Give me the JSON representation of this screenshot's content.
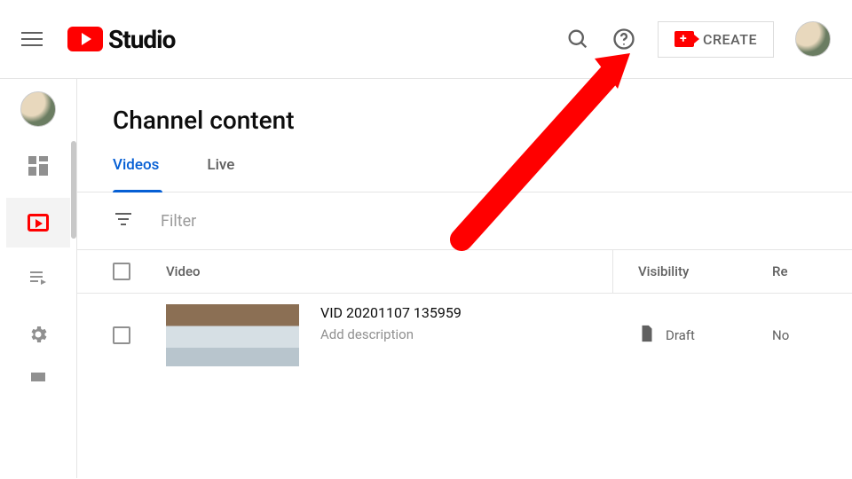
{
  "header": {
    "logo_text": "Studio",
    "create_label": "CREATE"
  },
  "page": {
    "title": "Channel content"
  },
  "tabs": [
    {
      "label": "Videos",
      "active": true
    },
    {
      "label": "Live",
      "active": false
    }
  ],
  "filter": {
    "placeholder": "Filter"
  },
  "table": {
    "columns": {
      "video": "Video",
      "visibility": "Visibility",
      "re": "Re"
    },
    "rows": [
      {
        "title": "VID 20201107 135959",
        "description_placeholder": "Add description",
        "visibility": "Draft",
        "re": "No"
      }
    ]
  }
}
